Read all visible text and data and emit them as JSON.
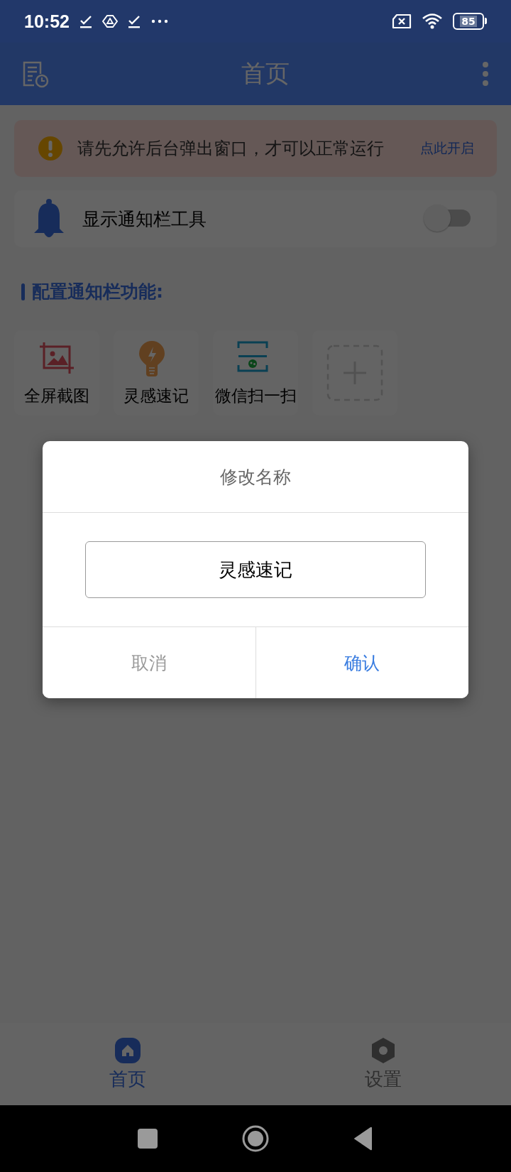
{
  "status_bar": {
    "time": "10:52",
    "battery": "85"
  },
  "header": {
    "title": "首页"
  },
  "banner": {
    "message": "请先允许后台弹出窗口，才可以正常运行",
    "link": "点此开启"
  },
  "notification_toggle": {
    "label": "显示通知栏工具",
    "on": false
  },
  "section_title": "配置通知栏功能:",
  "functions": [
    {
      "kind": "screenshot",
      "label": "全屏截图"
    },
    {
      "kind": "idea",
      "label": "灵感速记"
    },
    {
      "kind": "scan",
      "label": "微信扫一扫"
    },
    {
      "kind": "add"
    }
  ],
  "dialog": {
    "title": "修改名称",
    "value": "灵感速记",
    "buttons": [
      {
        "kind": "cancel",
        "label": "取消"
      },
      {
        "kind": "confirm",
        "label": "确认"
      }
    ]
  },
  "bottom_nav": [
    {
      "kind": "home",
      "label": "首页",
      "selected": true
    },
    {
      "kind": "settings",
      "label": "设置",
      "selected": false
    }
  ]
}
